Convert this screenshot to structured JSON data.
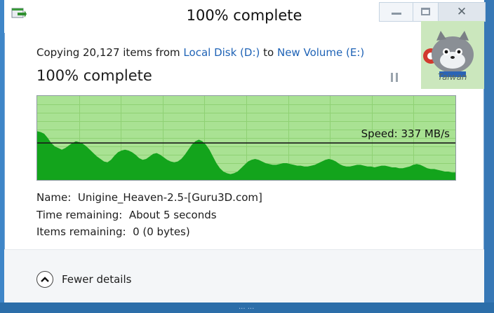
{
  "window": {
    "title": "100% complete",
    "controls": {
      "minimize": "minimize",
      "maximize": "maximize",
      "close": "✕"
    }
  },
  "copy": {
    "prefix": "Copying 20,127 items from ",
    "source": "Local Disk (D:)",
    "middle": " to ",
    "destination": "New Volume (E:)"
  },
  "progress": {
    "label": "100% complete",
    "fraction": 1.0
  },
  "graph": {
    "speed_label": "Speed: 337 MB/s",
    "speed_fraction": 0.44,
    "throughput_profile": [
      0.58,
      0.57,
      0.55,
      0.5,
      0.44,
      0.4,
      0.38,
      0.36,
      0.38,
      0.41,
      0.44,
      0.46,
      0.45,
      0.43,
      0.4,
      0.36,
      0.32,
      0.28,
      0.25,
      0.22,
      0.21,
      0.24,
      0.29,
      0.33,
      0.35,
      0.36,
      0.35,
      0.33,
      0.3,
      0.26,
      0.24,
      0.25,
      0.28,
      0.31,
      0.32,
      0.3,
      0.27,
      0.24,
      0.22,
      0.21,
      0.22,
      0.25,
      0.3,
      0.36,
      0.42,
      0.46,
      0.48,
      0.46,
      0.42,
      0.36,
      0.28,
      0.2,
      0.14,
      0.1,
      0.08,
      0.07,
      0.08,
      0.1,
      0.14,
      0.18,
      0.22,
      0.24,
      0.25,
      0.24,
      0.22,
      0.2,
      0.19,
      0.18,
      0.18,
      0.19,
      0.2,
      0.2,
      0.19,
      0.18,
      0.17,
      0.17,
      0.16,
      0.16,
      0.17,
      0.18,
      0.2,
      0.22,
      0.24,
      0.25,
      0.24,
      0.22,
      0.19,
      0.17,
      0.16,
      0.16,
      0.17,
      0.18,
      0.18,
      0.17,
      0.16,
      0.16,
      0.15,
      0.16,
      0.17,
      0.17,
      0.16,
      0.15,
      0.15,
      0.14,
      0.14,
      0.15,
      0.16,
      0.18,
      0.19,
      0.18,
      0.16,
      0.14,
      0.13,
      0.13,
      0.12,
      0.11,
      0.1,
      0.1,
      0.09,
      0.09
    ],
    "colors": {
      "fill": "#13a41c",
      "background": "#a9e293",
      "grid": "#8fd174",
      "speed_line": "#1a1a1a"
    }
  },
  "details": {
    "name_label": "Name:",
    "name_value": "Unigine_Heaven-2.5-[Guru3D.com]",
    "time_label": "Time remaining:",
    "time_value": "About 5 seconds",
    "items_label": "Items remaining:",
    "items_value": "0 (0 bytes)"
  },
  "footer": {
    "toggle_label": "Fewer details",
    "toggle_icon": "chevron-up-icon"
  },
  "overlay": {
    "watermark_text": "Taiwan"
  },
  "background": {
    "bottom_text": "...   ..."
  }
}
